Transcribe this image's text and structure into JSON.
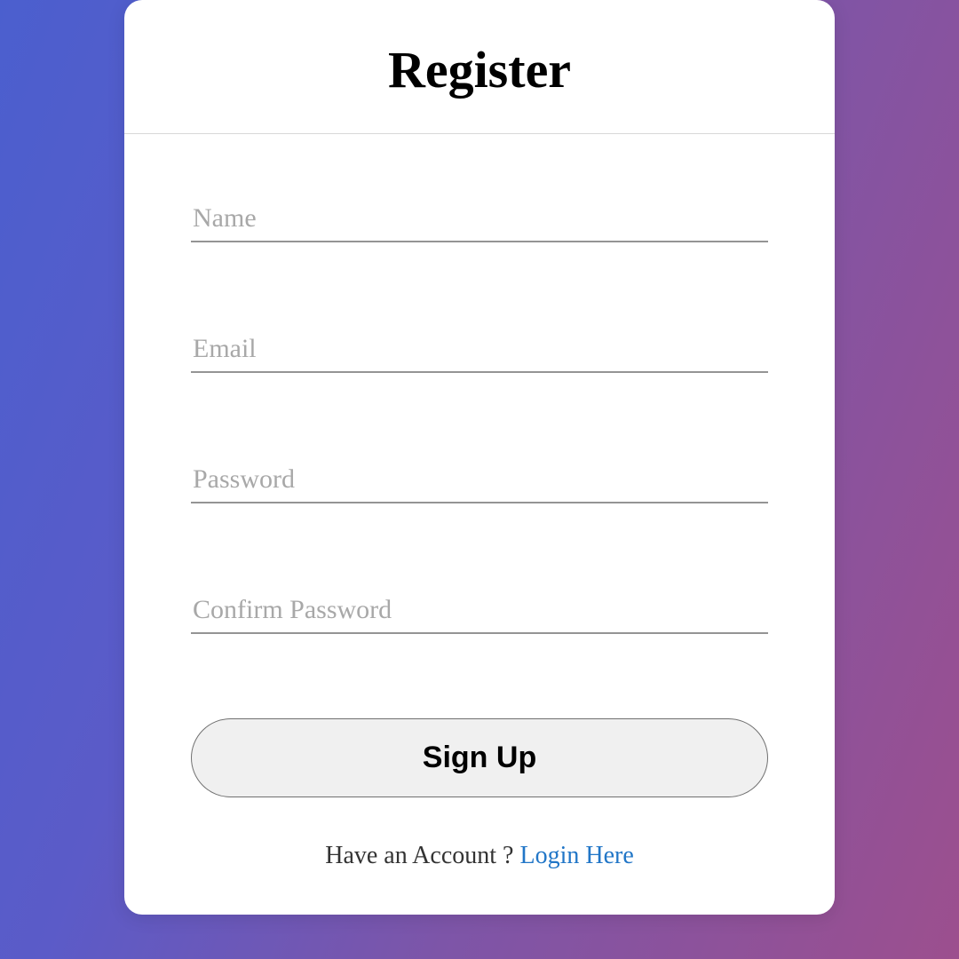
{
  "header": {
    "title": "Register"
  },
  "form": {
    "name": {
      "placeholder": "Name",
      "value": ""
    },
    "email": {
      "placeholder": "Email",
      "value": ""
    },
    "password": {
      "placeholder": "Password",
      "value": ""
    },
    "confirm_password": {
      "placeholder": "Confirm Password",
      "value": ""
    },
    "submit_label": "Sign Up"
  },
  "footer": {
    "prompt": "Have an Account ? ",
    "link_text": "Login Here"
  }
}
